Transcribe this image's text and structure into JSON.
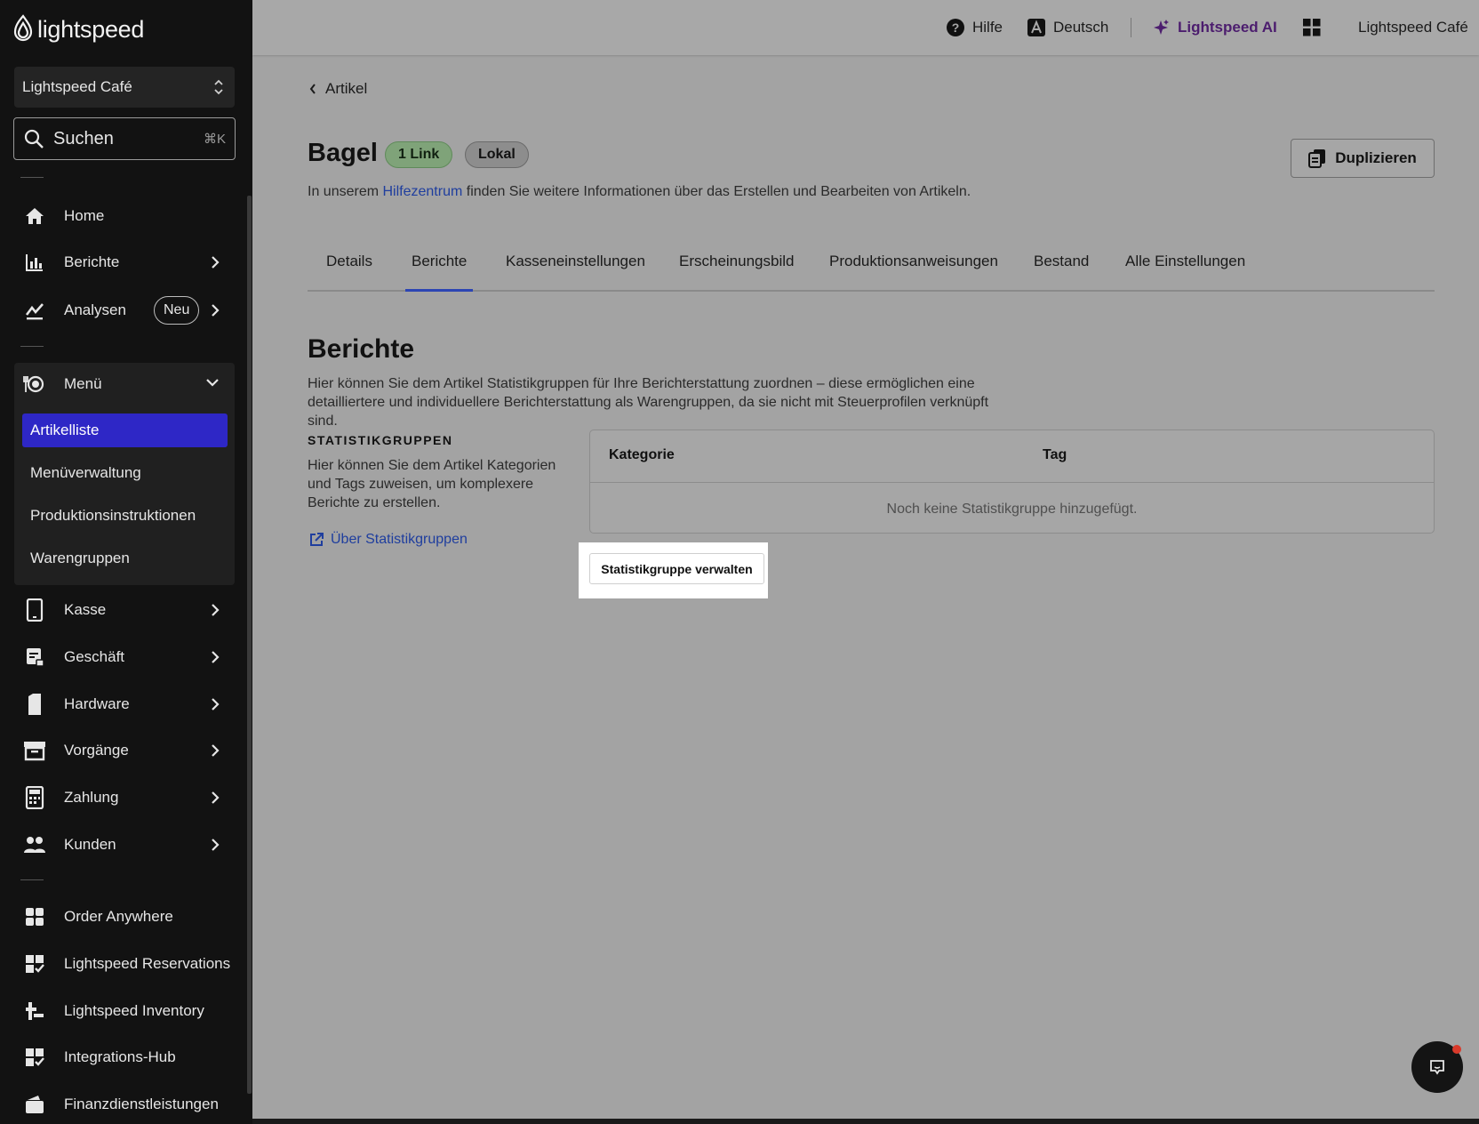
{
  "sidebar": {
    "logo_text": "lightspeed",
    "store_select": "Lightspeed Café",
    "search": {
      "placeholder": "Suchen",
      "shortcut": "⌘K"
    },
    "items": [
      {
        "label": "Home",
        "icon": "home-icon"
      },
      {
        "label": "Berichte",
        "icon": "bar-chart-icon"
      },
      {
        "label": "Analysen",
        "icon": "trend-chart-icon",
        "badge": "Neu"
      },
      {
        "label": "Menü",
        "icon": "menu-dish-icon"
      },
      {
        "label": "Kasse",
        "icon": "tablet-icon"
      },
      {
        "label": "Geschäft",
        "icon": "store-receipt-icon"
      },
      {
        "label": "Hardware",
        "icon": "hardware-icon"
      },
      {
        "label": "Vorgänge",
        "icon": "archive-icon"
      },
      {
        "label": "Zahlung",
        "icon": "calculator-icon"
      },
      {
        "label": "Kunden",
        "icon": "people-icon"
      },
      {
        "label": "Order Anywhere",
        "icon": "order-anywhere-icon"
      },
      {
        "label": "Lightspeed Reservations",
        "icon": "reservations-icon"
      },
      {
        "label": "Lightspeed Inventory",
        "icon": "inventory-icon"
      },
      {
        "label": "Integrations-Hub",
        "icon": "integrations-icon"
      },
      {
        "label": "Finanzdienstleistungen",
        "icon": "wallet-icon"
      }
    ],
    "menu_sub": [
      "Artikelliste",
      "Menüverwaltung",
      "Produktionsinstruktionen",
      "Warengruppen"
    ]
  },
  "topbar": {
    "help": "Hilfe",
    "language": "Deutsch",
    "ai": "Lightspeed AI",
    "account": "Lightspeed Café"
  },
  "main": {
    "back": "Artikel",
    "title": "Bagel",
    "pill_link": "1 Link",
    "pill_lokal": "Lokal",
    "duplicate": "Duplizieren",
    "subtitle_pre": "In unserem ",
    "subtitle_link": "Hilfezentrum",
    "subtitle_post": " finden Sie weitere Informationen über das Erstellen und Bearbeiten von Artikeln.",
    "tabs": [
      "Details",
      "Berichte",
      "Kasseneinstellungen",
      "Erscheinungsbild",
      "Produktionsanweisungen",
      "Bestand",
      "Alle Einstellungen"
    ],
    "section_title": "Berichte",
    "section_desc": "Hier können Sie dem Artikel Statistikgruppen für Ihre Berichterstattung zuordnen – diese ermöglichen eine detailliertere und individuellere Berichterstattung als Warengruppen, da sie nicht mit Steuerprofilen verknüpft sind.",
    "group_heading": "STATISTIKGRUPPEN",
    "group_desc": "Hier können Sie dem Artikel Kategorien und Tags zuweisen, um komplexere Berichte zu erstellen.",
    "about_link": "Über Statistikgruppen",
    "table": {
      "col_category": "Kategorie",
      "col_tag": "Tag",
      "empty": "Noch keine Statistikgruppe hinzugefügt."
    },
    "manage_button": "Statistikgruppe verwalten"
  },
  "colors": {
    "active_item": "#2e27c6",
    "link": "#1f3e9e",
    "ai": "#4c1d6e",
    "tab_underline": "#2c45b3"
  }
}
